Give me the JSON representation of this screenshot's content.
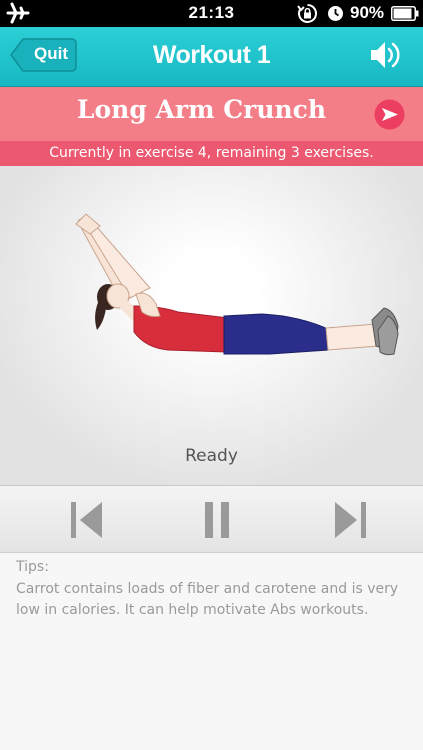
{
  "status_bar": {
    "time": "21:13",
    "battery_percent": "90%",
    "battery_level": 0.9,
    "icons": [
      "airplane-icon",
      "rotation-lock-icon",
      "alarm-icon",
      "battery-icon"
    ]
  },
  "nav": {
    "back_label": "Quit",
    "title": "Workout 1",
    "sound_icon": "speaker-icon"
  },
  "exercise": {
    "name": "Long Arm Crunch",
    "progress_text": "Currently in exercise 4, remaining 3 exercises.",
    "next_icon": "play-arrow-icon"
  },
  "state_label": "Ready",
  "controls": {
    "previous_icon": "skip-previous-icon",
    "pause_icon": "pause-icon",
    "next_icon": "skip-next-icon"
  },
  "tips": {
    "heading": "Tips:",
    "text": "Carrot contains loads of fiber and carotene and is very low in calories. It can help motivate Abs workouts."
  },
  "colors": {
    "nav_teal": "#1fc2cb",
    "header_pink": "#f47e88",
    "strip_pink": "#ec5870",
    "shirt_red": "#d82e3c",
    "pants_navy": "#2a2e8a"
  }
}
